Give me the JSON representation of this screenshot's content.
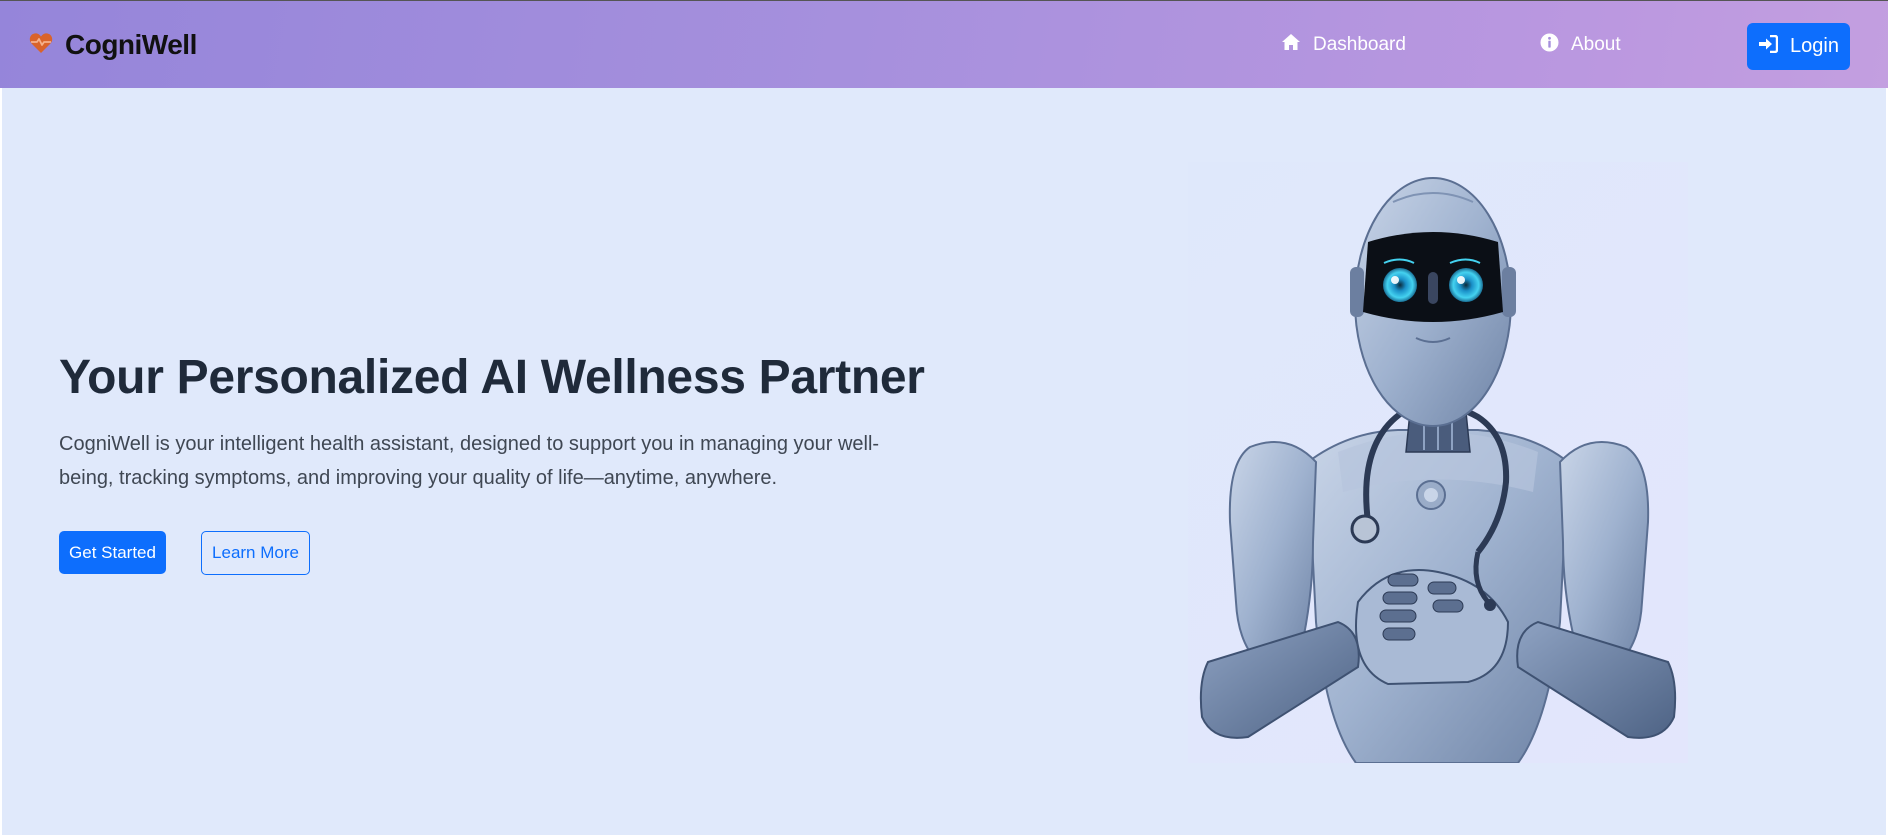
{
  "brand": {
    "name": "CogniWell",
    "icon": "heart-pulse-icon",
    "icon_color": "#d9632b"
  },
  "nav": {
    "dashboard": {
      "label": "Dashboard",
      "icon": "home-icon"
    },
    "about": {
      "label": "About",
      "icon": "info-circle-icon"
    },
    "login": {
      "label": "Login",
      "icon": "sign-in-icon"
    }
  },
  "hero": {
    "title": "Your Personalized AI Wellness Partner",
    "description": "CogniWell is your intelligent health assistant, designed to support you in managing your well-being, tracking symptoms, and improving your quality of life—anytime, anywhere.",
    "primary_button": "Get Started",
    "secondary_button": "Learn More",
    "image": "ai-doctor-robot-illustration"
  },
  "colors": {
    "accent": "#0d6efd",
    "hero_bg": "#e0e9fb",
    "nav_gradient_start": "#9585da",
    "nav_gradient_end": "#c39fe0"
  }
}
